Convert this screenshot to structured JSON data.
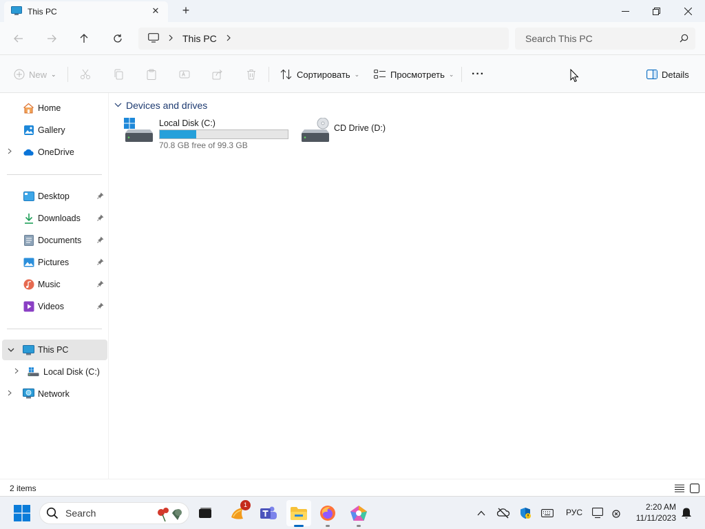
{
  "window": {
    "tab_title": "This PC",
    "tab_close": "✕",
    "new_tab": "+",
    "minimize": "—",
    "maximize": "❐",
    "close": "✕"
  },
  "address": {
    "crumbs": [
      "This PC"
    ],
    "separator": ">",
    "search_placeholder": "Search This PC"
  },
  "commands": {
    "new_label": "New",
    "sort_label": "Сортировать",
    "view_label": "Просмотреть",
    "more_label": "···",
    "details_label": "Details"
  },
  "sidebar": {
    "top": [
      {
        "label": "Home",
        "icon": "home-icon"
      },
      {
        "label": "Gallery",
        "icon": "gallery-icon"
      },
      {
        "label": "OneDrive",
        "icon": "onedrive-icon",
        "expandable": true
      }
    ],
    "quick_access": [
      {
        "label": "Desktop",
        "icon": "desktop-folder-icon",
        "pinned": true
      },
      {
        "label": "Downloads",
        "icon": "downloads-icon",
        "pinned": true
      },
      {
        "label": "Documents",
        "icon": "documents-icon",
        "pinned": true
      },
      {
        "label": "Pictures",
        "icon": "pictures-icon",
        "pinned": true
      },
      {
        "label": "Music",
        "icon": "music-icon",
        "pinned": true
      },
      {
        "label": "Videos",
        "icon": "videos-icon",
        "pinned": true
      }
    ],
    "tree": [
      {
        "label": "This PC",
        "icon": "this-pc-icon",
        "expanded": true,
        "selected": true
      },
      {
        "label": "Local Disk (C:)",
        "icon": "local-disk-icon"
      },
      {
        "label": "Network",
        "icon": "network-icon"
      }
    ]
  },
  "main": {
    "group_title": "Devices and drives",
    "drives": [
      {
        "name": "Local Disk (C:)",
        "free_text": "70.8 GB free of 99.3 GB",
        "used_fraction": 0.287
      },
      {
        "name": "CD Drive (D:)"
      }
    ]
  },
  "status": {
    "item_count": "2 items"
  },
  "taskbar": {
    "search_label": "Search",
    "badge_count": "1",
    "language": "РУС",
    "time": "2:20 AM",
    "date": "11/11/2023"
  },
  "colors": {
    "accent": "#0067c0",
    "drive_bar_fill": "#26a0da",
    "group_title": "#1d3a70",
    "selected_bg": "#e5e5e5",
    "notification_badge": "#c42b1c"
  }
}
